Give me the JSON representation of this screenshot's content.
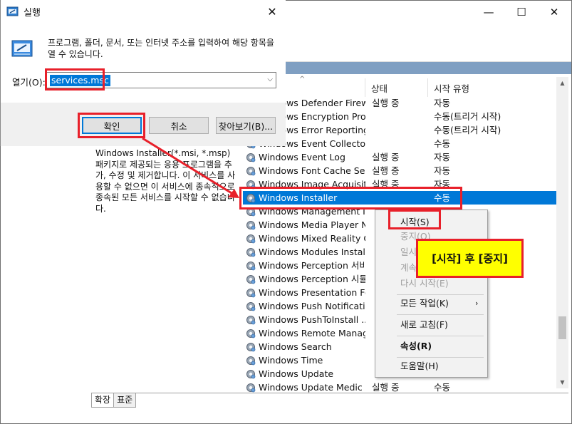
{
  "colors": {
    "highlight": "#e8202a",
    "selection": "#0078d7",
    "callout_bg": "#ffff00"
  },
  "run_dialog": {
    "title": "실행",
    "description": "프로그램, 폴더, 문서, 또는 인터넷 주소를 입력하여 해당 항목을 열 수 있습니다.",
    "open_label": "열기(O):",
    "input_value": "services.msc",
    "ok_label": "확인",
    "cancel_label": "취소",
    "browse_label": "찾아보기(B)...",
    "icons": [
      "run-icon",
      "close-icon",
      "chevron-down-icon"
    ]
  },
  "services": {
    "columns": {
      "status": "상태",
      "startup": "시작 유형"
    },
    "description": "Windows Installer(*.msi, *.msp) 패키지로 제공되는 응용 프로그램을 추가, 수정 및 제거합니다. 이 서비스를 사용할 수 없으면 이 서비스에 종속적으로 종속된 모든 서비스를 시작할 수 없습니다.",
    "rows": [
      {
        "name": "Windows Defender Firewall",
        "status": "실행 중",
        "start": "자동"
      },
      {
        "name": "Windows Encryption Prov...",
        "status": "",
        "start": "수동(트리거 시작)"
      },
      {
        "name": "Windows Error Reporting ...",
        "status": "",
        "start": "수동(트리거 시작)"
      },
      {
        "name": "Windows Event Collector",
        "status": "",
        "start": "수동"
      },
      {
        "name": "Windows Event Log",
        "status": "실행 중",
        "start": "자동"
      },
      {
        "name": "Windows Font Cache Ser...",
        "status": "실행 중",
        "start": "자동"
      },
      {
        "name": "Windows Image Acquisiti...",
        "status": "실행 중",
        "start": "자동"
      },
      {
        "name": "Windows Installer",
        "status": "",
        "start": "수동"
      },
      {
        "name": "Windows Management In...",
        "status": "",
        "start": ""
      },
      {
        "name": "Windows Media Player N...",
        "status": "",
        "start": ""
      },
      {
        "name": "Windows Mixed Reality O...",
        "status": "",
        "start": ""
      },
      {
        "name": "Windows Modules Installer",
        "status": "",
        "start": ""
      },
      {
        "name": "Windows Perception 서비...",
        "status": "",
        "start": ""
      },
      {
        "name": "Windows Perception 시뮬...",
        "status": "",
        "start": ""
      },
      {
        "name": "Windows Presentation Fo...",
        "status": "",
        "start": ""
      },
      {
        "name": "Windows Push Notificati...",
        "status": "",
        "start": ""
      },
      {
        "name": "Windows PushToInstall ...",
        "status": "",
        "start": ""
      },
      {
        "name": "Windows Remote Manag...",
        "status": "",
        "start": ""
      },
      {
        "name": "Windows Search",
        "status": "",
        "start": ""
      },
      {
        "name": "Windows Time",
        "status": "",
        "start": ""
      },
      {
        "name": "Windows Update",
        "status": "",
        "start": ""
      },
      {
        "name": "Windows Update Medic ...",
        "status": "실행 중",
        "start": "수동"
      }
    ],
    "tabs": [
      "확장",
      "표준"
    ]
  },
  "context_menu": {
    "start": "시작(S)",
    "stop": "중지(O)",
    "pause": "일시 중지(U)",
    "resume": "계속(M)",
    "restart": "다시 시작(E)",
    "all_tasks": "모든 작업(K)",
    "refresh": "새로 고침(F)",
    "properties": "속성(R)",
    "help": "도움말(H)"
  },
  "callout": "[시작] 후 [중지]"
}
